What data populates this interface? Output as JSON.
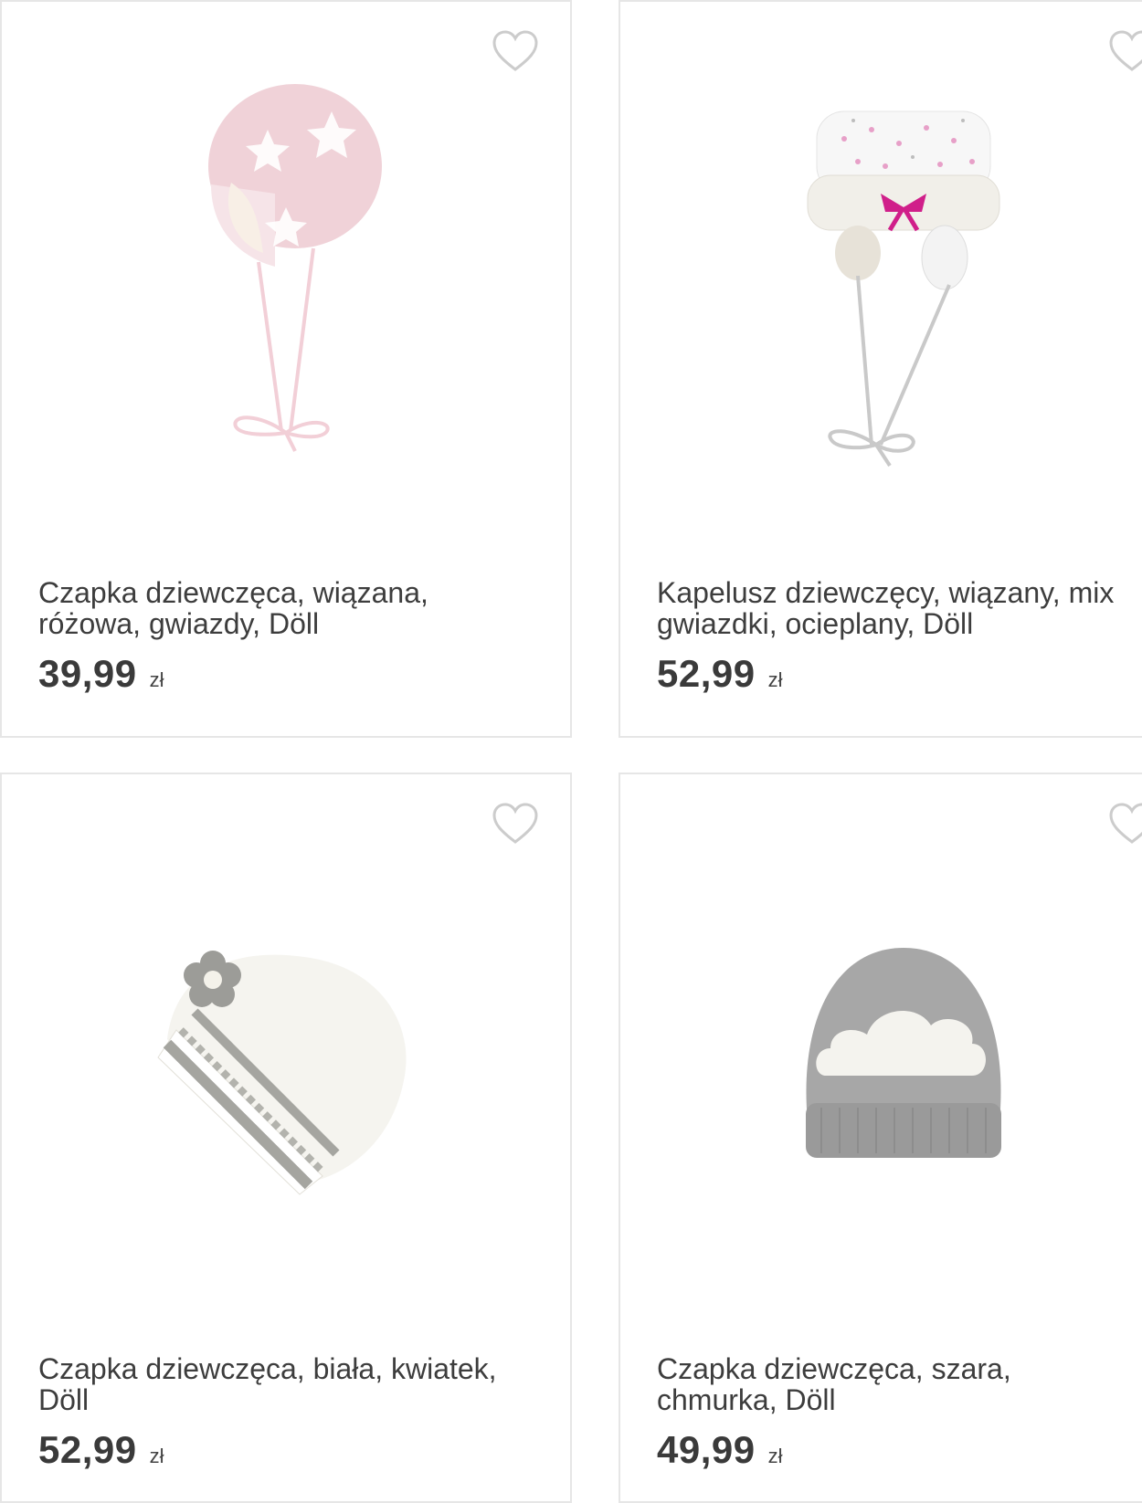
{
  "products": [
    {
      "title": "Czapka dziewczęca, wiązana,\nróżowa, gwiazdy, Döll",
      "price": "39,99",
      "currency": "zł",
      "image": "pink-bonnet-with-stars",
      "wishlist_icon": "heart-outline-icon"
    },
    {
      "title": "Kapelusz dziewczęcy, wiązany, mix\ngwiazdki, ocieplany, Döll",
      "price": "52,99",
      "currency": "zł",
      "image": "white-dotted-hat-with-bow",
      "wishlist_icon": "heart-outline-icon"
    },
    {
      "title": "Czapka dziewczęca, biała, kwiatek,\nDöll",
      "price": "52,99",
      "currency": "zł",
      "image": "white-knit-beanie-with-flower",
      "wishlist_icon": "heart-outline-icon"
    },
    {
      "title": "Czapka dziewczęca, szara,\nchmurka, Döll",
      "price": "49,99",
      "currency": "zł",
      "image": "grey-beanie-with-cloud",
      "wishlist_icon": "heart-outline-icon"
    }
  ],
  "colors": {
    "text": "#3d3d3d",
    "border": "#e6e6e6",
    "heart": "#cccccc"
  }
}
